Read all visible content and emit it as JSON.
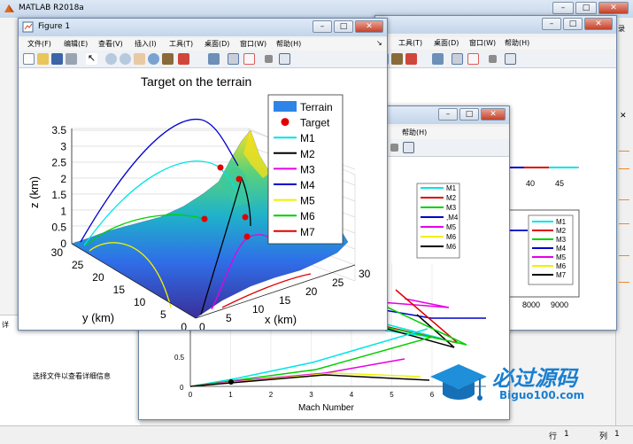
{
  "app": {
    "title": "MATLAB R2018a"
  },
  "figure1": {
    "title": "Figure 1",
    "menus": [
      "文件(F)",
      "编辑(E)",
      "查看(V)",
      "插入(I)",
      "工具(T)",
      "桌面(D)",
      "窗口(W)",
      "帮助(H)"
    ],
    "chart_data": {
      "type": "surface",
      "title": "Target on the terrain",
      "xlabel": "x (km)",
      "ylabel": "y (km)",
      "zlabel": "z (km)",
      "xlim": [
        0,
        30
      ],
      "ylim": [
        0,
        30
      ],
      "zlim": [
        0,
        3.5
      ],
      "x_ticks": [
        "0",
        "5",
        "10",
        "15",
        "20",
        "25",
        "30"
      ],
      "y_ticks": [
        "0",
        "5",
        "10",
        "15",
        "20",
        "25",
        "30"
      ],
      "z_ticks": [
        "0",
        "0.5",
        "1",
        "1.5",
        "2",
        "2.5",
        "3",
        "3.5"
      ],
      "grid": true,
      "legend_position": "top-right",
      "legend": [
        {
          "name": "Terrain",
          "color": "#2f84e8",
          "marker": "patch"
        },
        {
          "name": "Target",
          "color": "#e00000",
          "marker": "dot"
        },
        {
          "name": "M1",
          "color": "#00e5e5",
          "marker": "line"
        },
        {
          "name": "M2",
          "color": "#000000",
          "marker": "line"
        },
        {
          "name": "M3",
          "color": "#e600e6",
          "marker": "line"
        },
        {
          "name": "M4",
          "color": "#0000cc",
          "marker": "line"
        },
        {
          "name": "M5",
          "color": "#f0f000",
          "marker": "line"
        },
        {
          "name": "M6",
          "color": "#00d000",
          "marker": "line"
        },
        {
          "name": "M7",
          "color": "#e00000",
          "marker": "line"
        }
      ]
    }
  },
  "figure2": {
    "menus": [
      "帮助(H)"
    ],
    "chart_data": {
      "type": "line",
      "xlabel": "Mach Number",
      "x_ticks": [
        "0",
        "1",
        "2",
        "3",
        "4",
        "5",
        "6"
      ],
      "y_ticks": [
        "0",
        "0.5"
      ],
      "legend_position": "top-right",
      "legend": [
        {
          "name": "M1",
          "color": "#00e5e5"
        },
        {
          "name": "M2",
          "color": "#e00000"
        },
        {
          "name": "M3",
          "color": "#00d000"
        },
        {
          "name": ",M4",
          "color": "#0000cc"
        },
        {
          "name": "M5",
          "color": "#e600e6"
        },
        {
          "name": "M6",
          "color": "#f0f000"
        },
        {
          "name": "M6",
          "color": "#000000"
        }
      ]
    }
  },
  "figure3": {
    "menus": [
      "工具(T)",
      "桌面(D)",
      "窗口(W)",
      "帮助(H)"
    ],
    "chart_data": [
      {
        "type": "line",
        "x_ticks": [
          "40",
          "45"
        ]
      },
      {
        "type": "line",
        "x_ticks": [
          "8000",
          "9000"
        ],
        "legend_position": "top-right",
        "legend": [
          {
            "name": "M1",
            "color": "#00e5e5"
          },
          {
            "name": "M2",
            "color": "#e00000"
          },
          {
            "name": "M3",
            "color": "#00d000"
          },
          {
            "name": "M4",
            "color": "#0000cc"
          },
          {
            "name": "M5",
            "color": "#e600e6"
          },
          {
            "name": "M6",
            "color": "#f0f000"
          },
          {
            "name": "M7",
            "color": "#000000"
          }
        ]
      }
    ]
  },
  "left_panel": {
    "details_text": "选择文件以查看详细信息",
    "tab_label": "详"
  },
  "right_edge": {
    "partial_label": "录"
  },
  "status": {
    "line_label": "行",
    "line_value": "1",
    "col_label": "列",
    "col_value": "1"
  },
  "watermark": {
    "brand": "必过源码",
    "url": "Biguo100.com"
  }
}
